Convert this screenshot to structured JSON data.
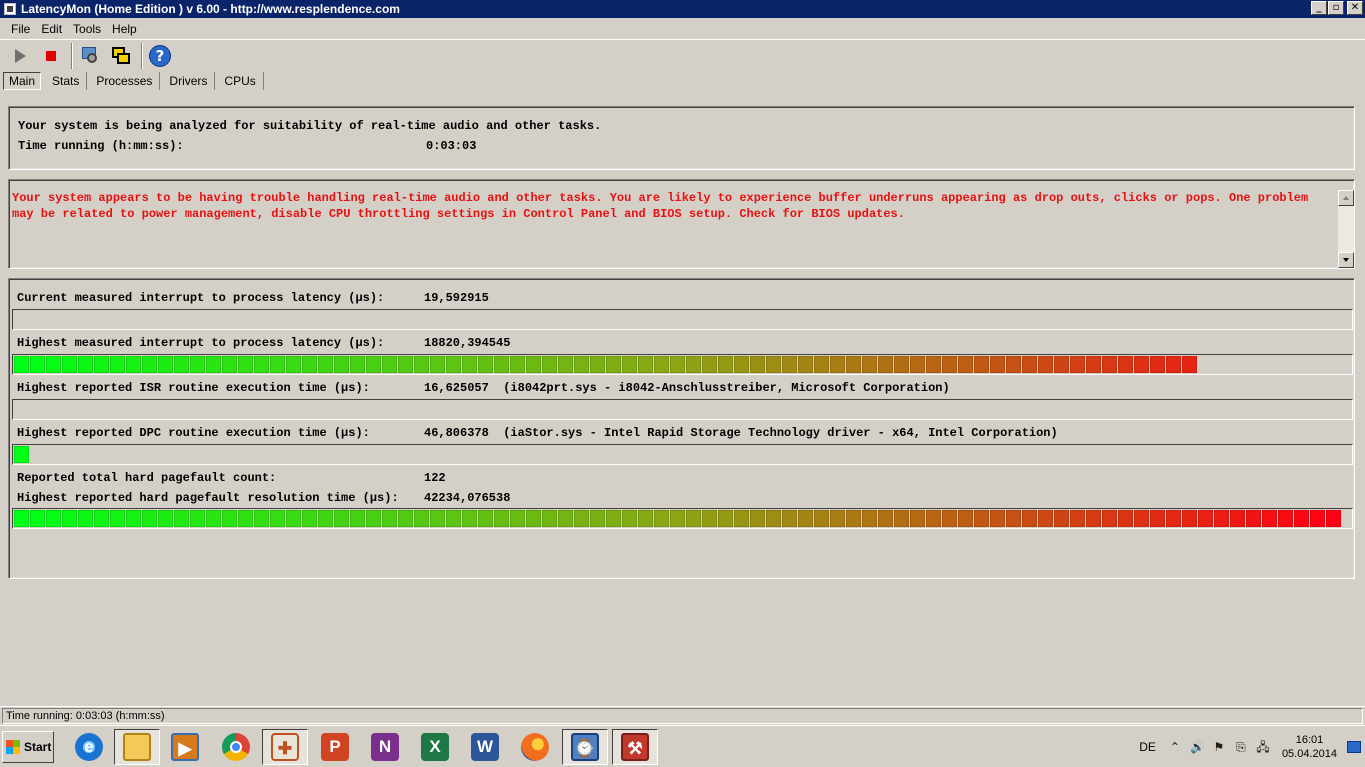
{
  "window": {
    "title": "LatencyMon  (Home Edition )  v 6.00 - http://www.resplendence.com",
    "buttons": {
      "minimize": "_",
      "maximize": "▫",
      "close": "✕"
    }
  },
  "menu": [
    {
      "label": "File"
    },
    {
      "label": "Edit"
    },
    {
      "label": "Tools"
    },
    {
      "label": "Help"
    }
  ],
  "toolbar": {
    "icons": [
      "play-icon",
      "stop-icon",
      "configure-icon",
      "windows-icon",
      "help-icon"
    ],
    "help_glyph": "?",
    "stop_color": "#e00000"
  },
  "tabs": [
    {
      "label": "Main",
      "active": true
    },
    {
      "label": "Stats"
    },
    {
      "label": "Processes"
    },
    {
      "label": "Drivers"
    },
    {
      "label": "CPUs"
    }
  ],
  "status_panel": {
    "line1": "Your system is being analyzed for suitability of real-time audio and other tasks.",
    "time_label": "Time running (h:mm:ss):",
    "time_value": "0:03:03"
  },
  "message": {
    "text": "Your system appears to be having trouble handling real-time audio and other tasks. You are likely to experience buffer underruns appearing as drop outs, clicks or pops. One problem may be related to power management, disable CPU throttling settings in Control Panel and BIOS setup. Check for BIOS updates.",
    "color": "#e81010"
  },
  "metrics": {
    "current_latency": {
      "label": "Current measured interrupt to process latency (µs):",
      "value": "19,592915",
      "bar_fill": 0.0
    },
    "highest_latency": {
      "label": "Highest measured interrupt to process latency (µs):",
      "value": "18820,394545",
      "bar_fill": 0.894
    },
    "isr": {
      "label": "Highest reported ISR routine execution time (µs):",
      "value": "16,625057  (i8042prt.sys - i8042-Anschlusstreiber, Microsoft Corporation)",
      "bar_fill": 0.0
    },
    "dpc": {
      "label": "Highest reported DPC routine execution time (µs):",
      "value": "46,806378  (iaStor.sys - Intel Rapid Storage Technology driver - x64, Intel Corporation)",
      "bar_fill": 0.012
    },
    "pagefault_count": {
      "label": "Reported total hard pagefault count:",
      "value": "122"
    },
    "pagefault_time": {
      "label": "Highest reported hard pagefault resolution time (µs):",
      "value": "42234,076538",
      "bar_fill": 1.0
    }
  },
  "statusbar": {
    "text": "Time running: 0:03:03  (h:mm:ss)"
  },
  "taskbar": {
    "start_label": "Start",
    "apps": [
      {
        "name": "internet-explorer-icon",
        "glyph": "e"
      },
      {
        "name": "file-explorer-icon",
        "glyph": ""
      },
      {
        "name": "media-player-icon",
        "glyph": "▶"
      },
      {
        "name": "chrome-icon",
        "glyph": ""
      },
      {
        "name": "paint-icon",
        "glyph": "✚"
      },
      {
        "name": "powerpoint-icon",
        "glyph": "P"
      },
      {
        "name": "onenote-icon",
        "glyph": "N"
      },
      {
        "name": "excel-icon",
        "glyph": "X"
      },
      {
        "name": "word-icon",
        "glyph": "W"
      },
      {
        "name": "firefox-icon",
        "glyph": ""
      },
      {
        "name": "latencymon-icon",
        "glyph": "⌚"
      },
      {
        "name": "toolbox-icon",
        "glyph": "⚒"
      }
    ],
    "language": "DE",
    "time": "16:01",
    "date": "05.04.2014"
  }
}
